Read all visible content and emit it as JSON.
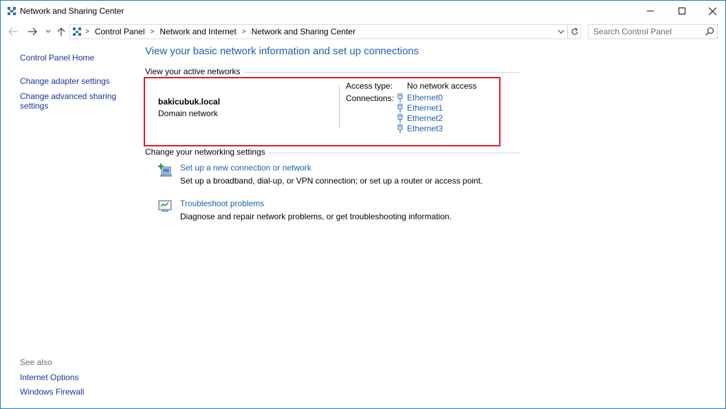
{
  "window": {
    "title": "Network and Sharing Center"
  },
  "address": {
    "crumbs": [
      "Control Panel",
      "Network and Internet",
      "Network and Sharing Center"
    ],
    "separator": ">",
    "search_placeholder": "Search Control Panel"
  },
  "left_pane": {
    "home": "Control Panel Home",
    "adapter": "Change adapter settings",
    "advanced": "Change advanced sharing settings",
    "see_also": "See also",
    "internet_options": "Internet Options",
    "firewall": "Windows Firewall"
  },
  "main": {
    "title": "View your basic network information and set up connections",
    "active_networks_heading": "View your active networks",
    "network": {
      "name": "bakicubuk.local",
      "type": "Domain network",
      "access_type_label": "Access type:",
      "access_type_value": "No network access",
      "connections_label": "Connections:",
      "connections": [
        "Ethernet0",
        "Ethernet1",
        "Ethernet2",
        "Ethernet3"
      ]
    },
    "settings_heading": "Change your networking settings",
    "tasks": {
      "setup": {
        "link": "Set up a new connection or network",
        "desc": "Set up a broadband, dial-up, or VPN connection; or set up a router or access point."
      },
      "troubleshoot": {
        "link": "Troubleshoot problems",
        "desc": "Diagnose and repair network problems, or get troubleshooting information."
      }
    }
  },
  "colors": {
    "link": "#1e5fae",
    "nav_link": "#1a3399",
    "highlight": "#e01b24",
    "window_border": "#1979ca"
  },
  "icons": {
    "title": "network-center-icon",
    "back": "back-arrow-icon",
    "forward": "forward-arrow-icon",
    "recent": "chevron-down-icon",
    "up": "up-arrow-icon",
    "refresh": "refresh-icon",
    "search": "search-icon",
    "connection": "ethernet-plug-icon",
    "setup": "new-connection-icon",
    "troubleshoot": "troubleshoot-icon"
  }
}
